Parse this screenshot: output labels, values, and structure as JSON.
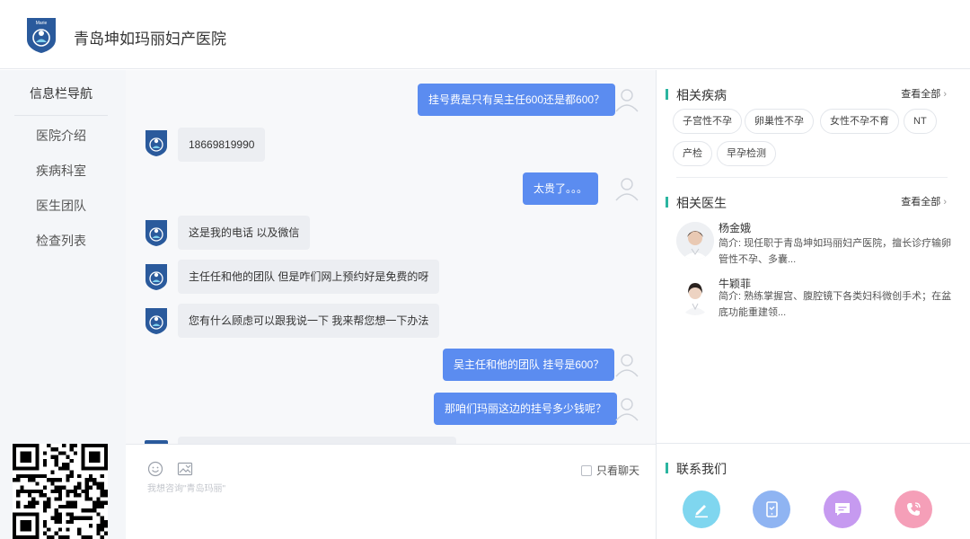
{
  "header": {
    "hospital_name": "青岛坤如玛丽妇产医院",
    "logo_text": "Marie"
  },
  "sidebar": {
    "title": "信息栏导航",
    "items": [
      {
        "label": "医院介绍"
      },
      {
        "label": "疾病科室"
      },
      {
        "label": "医生团队"
      },
      {
        "label": "检查列表"
      }
    ]
  },
  "chat": {
    "messages": [
      {
        "side": "out",
        "text": "挂号费是只有吴主任600还是都600？"
      },
      {
        "side": "in",
        "text": "18669819990"
      },
      {
        "side": "out",
        "text": "太贵了。。。"
      },
      {
        "side": "in",
        "text": "这是我的电话 以及微信"
      },
      {
        "side": "in",
        "text": "主任任和他的团队 但是咋们网上预约好是免费的呀"
      },
      {
        "side": "in",
        "text": "您有什么顾虑可以跟我说一下 我来帮您想一下办法"
      },
      {
        "side": "out",
        "text": "吴主任和他的团队 挂号是600？"
      },
      {
        "side": "out",
        "text": "那咱们玛丽这边的挂号多少钱呢？"
      }
    ]
  },
  "input": {
    "placeholder": "我想咨询\"青岛玛丽\"",
    "only_chat_label": "只看聊天",
    "only_chat_checked": false
  },
  "right_panel": {
    "diseases": {
      "title": "相关疾病",
      "view_all": "查看全部",
      "tags": [
        "子宫性不孕",
        "卵巢性不孕",
        "女性不孕不育",
        "NT",
        "产检",
        "早孕检测"
      ]
    },
    "doctors": {
      "title": "相关医生",
      "view_all": "查看全部",
      "list": [
        {
          "name": "杨金娥",
          "intro": "简介: 现任职于青岛坤如玛丽妇产医院，擅长诊疗输卵管性不孕、多囊..."
        },
        {
          "name": "牛颖菲",
          "intro": "简介: 熟练掌握宫、腹腔镜下各类妇科微创手术；在盆底功能重建领..."
        }
      ]
    },
    "contact": {
      "title": "联系我们",
      "buttons": [
        {
          "icon": "pen-icon",
          "color": "#7fd6ef"
        },
        {
          "icon": "phone-card-icon",
          "color": "#8fb4f2"
        },
        {
          "icon": "chat-bubble-icon",
          "color": "#c69af0"
        },
        {
          "icon": "phone-call-icon",
          "color": "#f59fb8"
        }
      ]
    }
  },
  "colors": {
    "accent_blue": "#5b8cf0",
    "section_bar": "#2bb5a0",
    "logo_blue": "#2a5a9c"
  }
}
